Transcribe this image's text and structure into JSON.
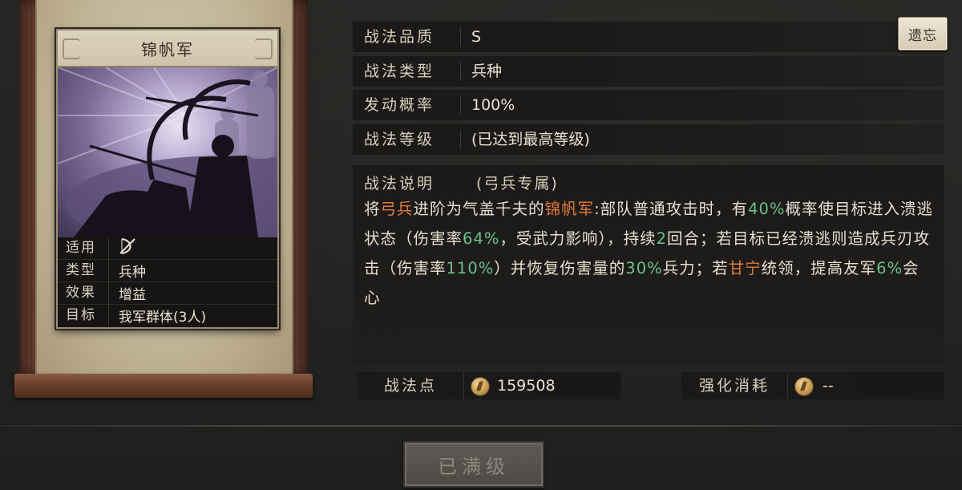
{
  "card": {
    "title": "锦帆军",
    "stats": [
      {
        "label": "适用",
        "value": "",
        "icon": "bow-icon"
      },
      {
        "label": "类型",
        "value": "兵种"
      },
      {
        "label": "效果",
        "value": "增益"
      },
      {
        "label": "目标",
        "value": "我军群体(3人)"
      }
    ]
  },
  "info": {
    "quality_label": "战法品质",
    "quality_value": "S",
    "type_label": "战法类型",
    "type_value": "兵种",
    "rate_label": "发动概率",
    "rate_value": "100%",
    "level_label": "战法等级",
    "level_value": "(已达到最高等级)"
  },
  "description": {
    "head": "战法说明",
    "tag": "(弓兵专属)",
    "segments": [
      {
        "t": "将",
        "c": ""
      },
      {
        "t": "弓兵",
        "c": "orange"
      },
      {
        "t": "进阶为气盖千夫的",
        "c": ""
      },
      {
        "t": "锦帆军",
        "c": "orange"
      },
      {
        "t": ":部队普通攻击时，有",
        "c": ""
      },
      {
        "t": "40%",
        "c": "green"
      },
      {
        "t": "概率使目标进入溃逃状态（伤害率",
        "c": ""
      },
      {
        "t": "64%",
        "c": "green"
      },
      {
        "t": "，受武力影响），持续",
        "c": ""
      },
      {
        "t": "2",
        "c": "green"
      },
      {
        "t": "回合；若目标已经溃逃则造成兵刃攻击（伤害率",
        "c": ""
      },
      {
        "t": "110%",
        "c": "green"
      },
      {
        "t": "）并恢复伤害量的",
        "c": ""
      },
      {
        "t": "30%",
        "c": "green"
      },
      {
        "t": "兵力；若",
        "c": ""
      },
      {
        "t": "甘宁",
        "c": "orange"
      },
      {
        "t": "统领，提高友军",
        "c": ""
      },
      {
        "t": "6%",
        "c": "green"
      },
      {
        "t": "会心",
        "c": ""
      }
    ]
  },
  "points": {
    "label": "战法点",
    "value": "159508",
    "cost_label": "强化消耗",
    "cost_value": "--"
  },
  "buttons": {
    "forget": "遗忘",
    "maxed": "已满级"
  },
  "colors": {
    "highlight_orange": "#e07b3a",
    "highlight_green": "#6cc08a"
  }
}
